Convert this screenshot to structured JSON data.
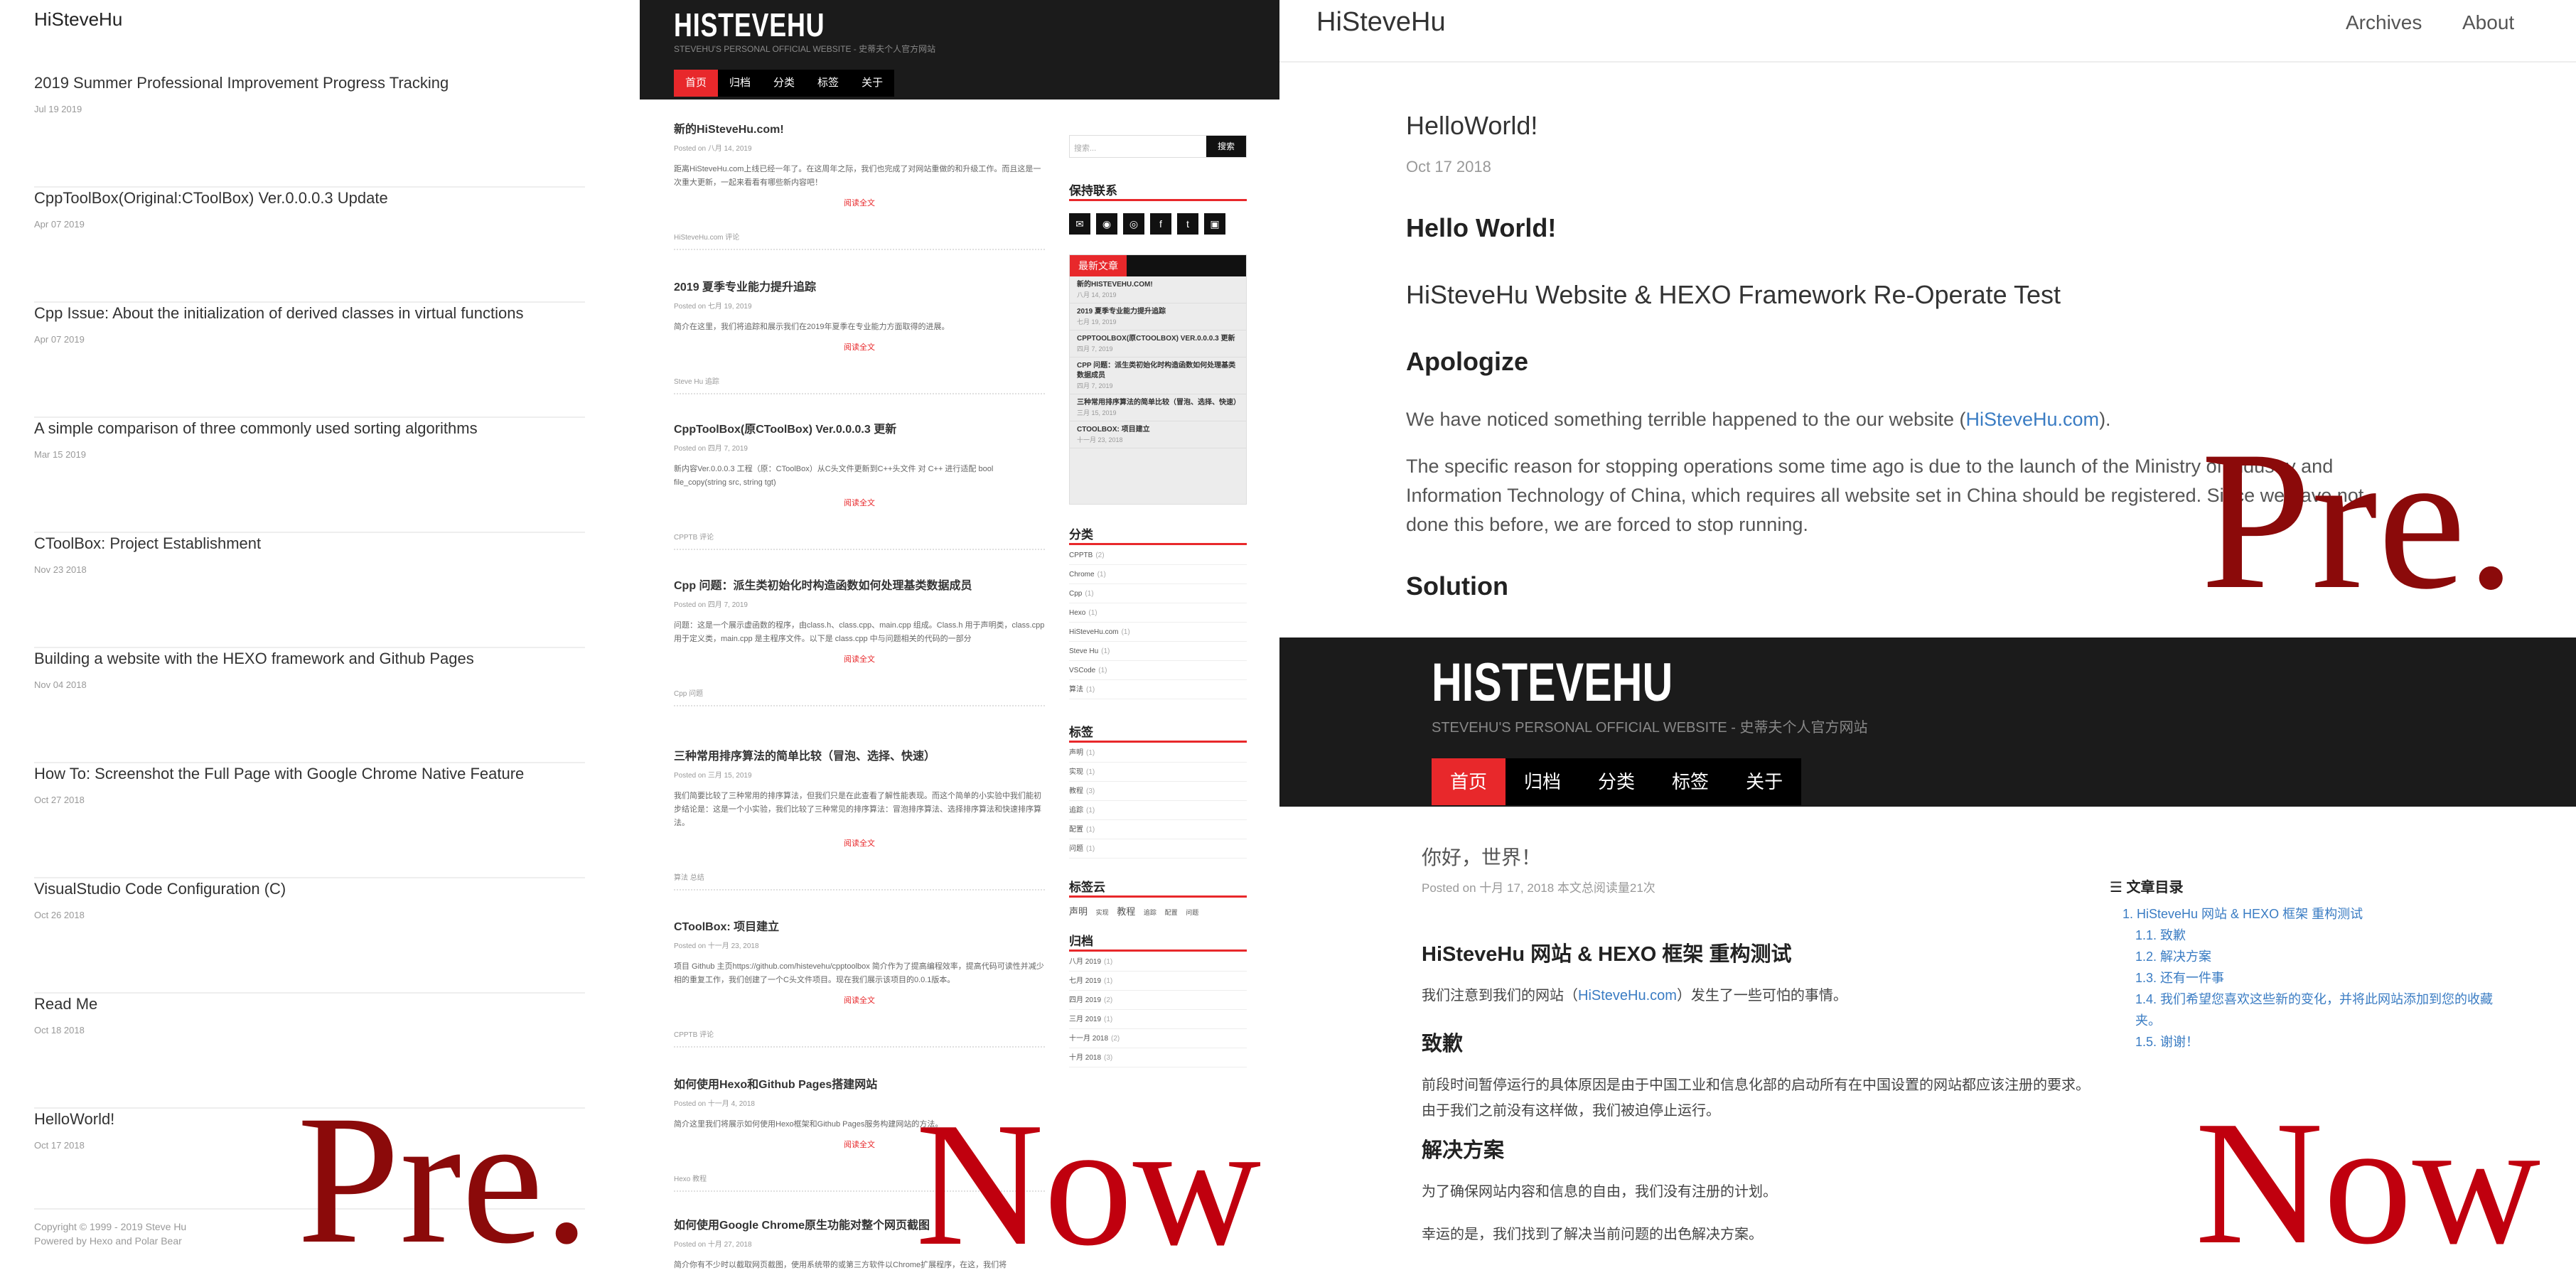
{
  "panel_old_list": {
    "site_title": "HiSteveHu",
    "posts": [
      {
        "title": "2019 Summer Professional Improvement Progress Tracking",
        "date": "Jul 19 2019"
      },
      {
        "title": "CppToolBox(Original:CToolBox) Ver.0.0.0.3 Update",
        "date": "Apr 07 2019"
      },
      {
        "title": "Cpp Issue: About the initialization of derived classes in virtual functions",
        "date": "Apr 07 2019"
      },
      {
        "title": "A simple comparison of three commonly used sorting algorithms",
        "date": "Mar 15 2019"
      },
      {
        "title": "CToolBox: Project Establishment",
        "date": "Nov 23 2018"
      },
      {
        "title": "Building a website with the HEXO framework and Github Pages",
        "date": "Nov 04 2018"
      },
      {
        "title": "How To: Screenshot the Full Page with Google Chrome Native Feature",
        "date": "Oct 27 2018"
      },
      {
        "title": "VisualStudio Code Configuration (C)",
        "date": "Oct 26 2018"
      },
      {
        "title": "Read Me",
        "date": "Oct 18 2018"
      },
      {
        "title": "HelloWorld!",
        "date": "Oct 17 2018"
      }
    ],
    "footer_copyright": "Copyright © 1999 - 2019  Steve Hu",
    "footer_powered": "Powered by Hexo and Polar Bear"
  },
  "panel_new_list": {
    "logo": "HISTEVEHU",
    "subtitle": "STEVEHU'S PERSONAL OFFICIAL WEBSITE - 史蒂夫个人官方网站",
    "nav": [
      "首页",
      "归档",
      "分类",
      "标签",
      "关于"
    ],
    "read_more": "阅读全文",
    "articles": [
      {
        "title": "新的HiSteveHu.com!",
        "meta": "Posted on 八月 14, 2019",
        "excerpt": "距离HiSteveHu.com上线已经一年了。在这周年之际，我们也完成了对网站重做的和升级工作。而且这是一次重大更新，一起来看看有哪些新内容吧！",
        "tags": "HiSteveHu.com    评论"
      },
      {
        "title": "2019 夏季专业能力提升追踪",
        "meta": "Posted on 七月 19, 2019",
        "excerpt": "简介在这里，我们将追踪和展示我们在2019年夏季在专业能力方面取得的进展。",
        "tags": "Steve Hu    追踪"
      },
      {
        "title": "CppToolBox(原CToolBox) Ver.0.0.0.3 更新",
        "meta": "Posted on 四月 7, 2019",
        "excerpt": "新内容Ver.0.0.0.3 工程（原：CToolBox）从C头文件更新到C++头文件 对 C++ 进行适配 bool file_copy(string src, string tgt)",
        "tags": "CPPTB    评论"
      },
      {
        "title": "Cpp 问题：派生类初始化时构造函数如何处理基类数据成员",
        "meta": "Posted on 四月 7, 2019",
        "excerpt": "问题：这是一个展示虚函数的程序，由class.h、class.cpp、main.cpp 组成。Class.h 用于声明类，class.cpp 用于定义类，main.cpp 是主程序文件。以下是 class.cpp 中与问题相关的代码的一部分",
        "tags": "Cpp    问题"
      },
      {
        "title": "三种常用排序算法的简单比较（冒泡、选择、快速）",
        "meta": "Posted on 三月 15, 2019",
        "excerpt": "我们简要比较了三种常用的排序算法，但我们只是在此查看了解性能表现。而这个简单的小实验中我们能初步结论是：这是一个小实验，我们比较了三种常见的排序算法：冒泡排序算法、选择排序算法和快速排序算法。",
        "tags": "算法    总结"
      },
      {
        "title": "CToolBox: 项目建立",
        "meta": "Posted on 十一月 23, 2018",
        "excerpt": "项目 Github 主页https://github.com/histevehu/cpptoolbox 简介作为了提高编程效率，提高代码可读性并减少相的重复工作，我们创建了一个C头文件项目。现在我们展示该项目的0.0.1版本。",
        "tags": "CPPTB    评论"
      },
      {
        "title": "如何使用Hexo和Github Pages搭建网站",
        "meta": "Posted on 十一月 4, 2018",
        "excerpt": "简介这里我们将展示如何使用Hexo框架和Github Pages服务构建网站的方法。",
        "tags": "Hexo    教程"
      },
      {
        "title": "如何使用Google Chrome原生功能对整个网页截图",
        "meta": "Posted on 十月 27, 2018",
        "excerpt": "简介你有不少时以截取网页截图，使用系统带的或第三方软件以Chrome扩展程序，在这，我们将",
        "tags": ""
      }
    ],
    "search_placeholder": "搜索...",
    "search_button": "搜索",
    "contact_title": "保持联系",
    "social_icons": [
      "mail-icon",
      "github-icon",
      "weibo-icon",
      "facebook-icon",
      "twitter-icon",
      "instagram-icon"
    ],
    "latest_title": "最新文章",
    "latest": [
      {
        "title": "新的HISTEVEHU.COM!",
        "date": "八月 14, 2019"
      },
      {
        "title": "2019 夏季专业能力提升追踪",
        "date": "七月 19, 2019"
      },
      {
        "title": "CPPTOOLBOX(原CTOOLBOX) VER.0.0.0.3 更新",
        "date": "四月 7, 2019"
      },
      {
        "title": "CPP 问题：派生类初始化时构造函数如何处理基类数据成员",
        "date": "四月 7, 2019"
      },
      {
        "title": "三种常用排序算法的简单比较（冒泡、选择、快速）",
        "date": "三月 15, 2019"
      },
      {
        "title": "CTOOLBOX: 项目建立",
        "date": "十一月 23, 2018"
      }
    ],
    "categories_title": "分类",
    "categories": [
      {
        "name": "CPPTB",
        "count": "(2)"
      },
      {
        "name": "Chrome",
        "count": "(1)"
      },
      {
        "name": "Cpp",
        "count": "(1)"
      },
      {
        "name": "Hexo",
        "count": "(1)"
      },
      {
        "name": "HiSteveHu.com",
        "count": "(1)"
      },
      {
        "name": "Steve Hu",
        "count": "(1)"
      },
      {
        "name": "VSCode",
        "count": "(1)"
      },
      {
        "name": "算法",
        "count": "(1)"
      }
    ],
    "tags_title": "标签",
    "tags": [
      {
        "name": "声明",
        "count": "(1)"
      },
      {
        "name": "实现",
        "count": "(1)"
      },
      {
        "name": "教程",
        "count": "(3)"
      },
      {
        "name": "追踪",
        "count": "(1)"
      },
      {
        "name": "配置",
        "count": "(1)"
      },
      {
        "name": "问题",
        "count": "(1)"
      }
    ],
    "cloud_title": "标签云",
    "cloud": [
      "声明",
      "实现",
      "教程",
      "追踪",
      "配置",
      "问题"
    ],
    "archive_title": "归档",
    "archives": [
      {
        "name": "八月 2019",
        "count": "(1)"
      },
      {
        "name": "七月 2019",
        "count": "(1)"
      },
      {
        "name": "四月 2019",
        "count": "(2)"
      },
      {
        "name": "三月 2019",
        "count": "(1)"
      },
      {
        "name": "十一月 2018",
        "count": "(2)"
      },
      {
        "name": "十月 2018",
        "count": "(3)"
      }
    ]
  },
  "panel_old_article": {
    "site_title": "HiSteveHu",
    "nav_archives": "Archives",
    "nav_about": "About",
    "post_title": "HelloWorld!",
    "post_date": "Oct 17 2018",
    "h_hello": "Hello World!",
    "h_test": "HiSteveHu Website & HEXO Framework Re-Operate Test",
    "h_apologize": "Apologize",
    "p1_text": "We have noticed something terrible happened to the our website (",
    "p1_link": "HiSteveHu.com",
    "p1_end": ").",
    "p2_line1": "The specific reason for stopping operations some time ago is due to the launch of the Ministry of Industry and",
    "p2_line2": "Information Technology of China, which requires all website set in China should be registered. Since we have not",
    "p2_line3": "done this before, we are forced to stop running.",
    "h_solution": "Solution"
  },
  "panel_new_article": {
    "logo": "HISTEVEHU",
    "subtitle": "STEVEHU'S PERSONAL OFFICIAL WEBSITE - 史蒂夫个人官方网站",
    "nav": [
      "首页",
      "归档",
      "分类",
      "标签",
      "关于"
    ],
    "post_title": "你好，世界！",
    "post_meta": "Posted on 十月 17, 2018 本文总阅读量21次",
    "h_test": "HiSteveHu 网站 & HEXO 框架 重构测试",
    "p1_text": "我们注意到我们的网站（",
    "p1_link": "HiSteveHu.com",
    "p1_end": "）发生了一些可怕的事情。",
    "h_apologize": "致歉",
    "p2_line1": "前段时间暂停运行的具体原因是由于中国工业和信息化部的启动所有在中国设置的网站都应该注册的要求。",
    "p2_line2": "由于我们之前没有这样做，我们被迫停止运行。",
    "h_solution": "解决方案",
    "p3": "为了确保网站内容和信息的自由，我们没有注册的计划。",
    "p4": "幸运的是，我们找到了解决当前问题的出色解决方案。",
    "toc_title": "文章目录",
    "toc": [
      "1. HiSteveHu 网站 & HEXO 框架 重构测试",
      "1.1. 致歉",
      "1.2. 解决方案",
      "1.3. 还有一件事",
      "1.4. 我们希望您喜欢这些新的变化，并将此网站添加到您的收藏",
      "夹。",
      "1.5. 谢谢！"
    ]
  },
  "labels": {
    "pre": "Pre.",
    "now": "Now"
  }
}
